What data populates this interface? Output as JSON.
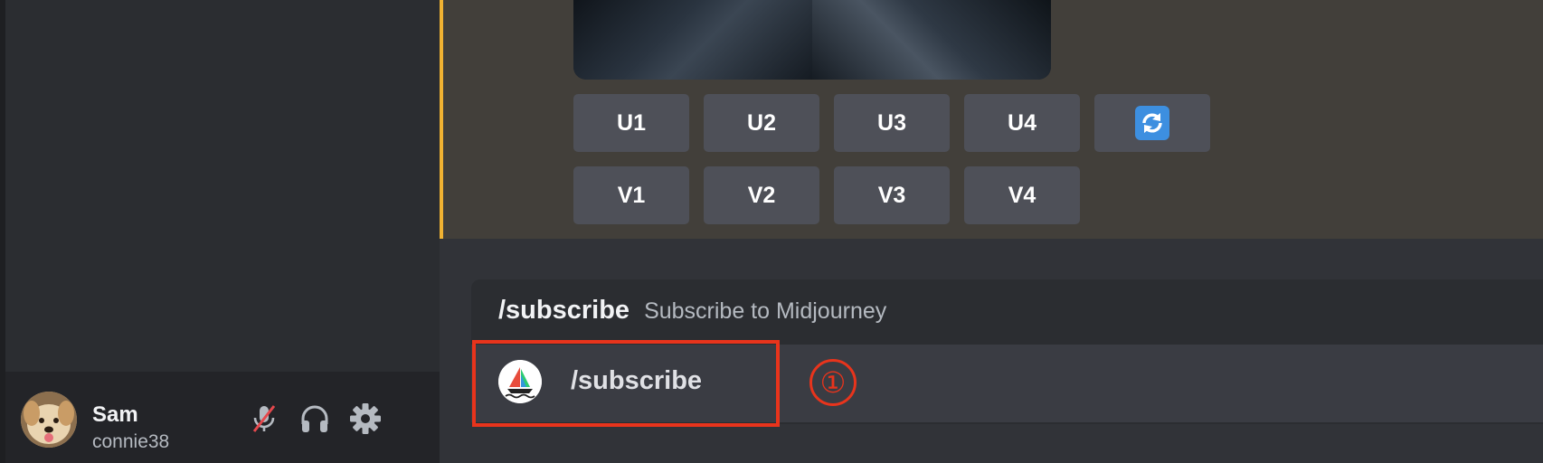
{
  "user_panel": {
    "display_name": "Sam",
    "username": "connie38",
    "controls": [
      {
        "name": "mute-microphone-icon",
        "state": "muted"
      },
      {
        "name": "headphones-icon"
      },
      {
        "name": "gear-icon"
      }
    ]
  },
  "message": {
    "accent_color": "#f0b232",
    "image_description_icon": "generated-image-grid",
    "buttons_row1": [
      "U1",
      "U2",
      "U3",
      "U4"
    ],
    "reroll_icon": "refresh-icon",
    "buttons_row2": [
      "V1",
      "V2",
      "V3",
      "V4"
    ]
  },
  "command_popup": {
    "command": "/subscribe",
    "description": "Subscribe to Midjourney",
    "option": {
      "bot_icon": "midjourney-sailboat-icon",
      "label": "/subscribe"
    }
  },
  "annotation": {
    "marker": "①",
    "color": "#e8341c"
  }
}
